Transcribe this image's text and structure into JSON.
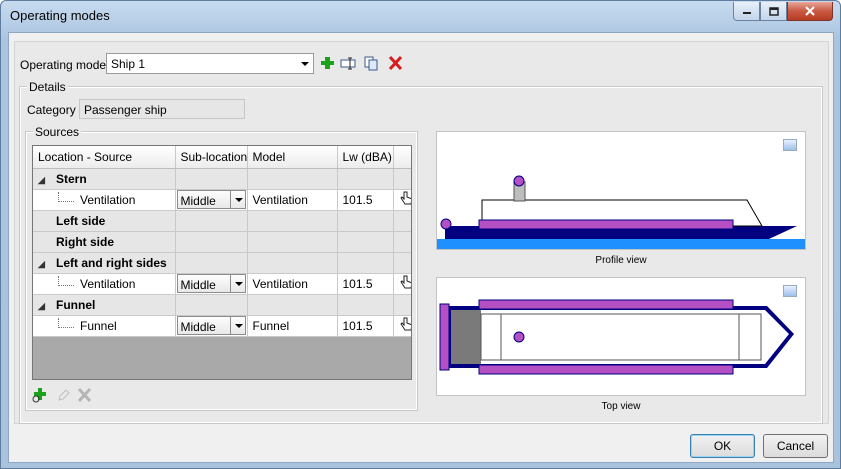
{
  "window": {
    "title": "Operating modes"
  },
  "operating_mode": {
    "label": "Operating mode",
    "value": "Ship 1"
  },
  "details": {
    "caption": "Details",
    "category_label": "Category",
    "category_value": "Passenger ship"
  },
  "sources": {
    "caption": "Sources",
    "columns": [
      "Location - Source",
      "Sub-location",
      "Model",
      "Lw (dBA)"
    ],
    "rows": [
      {
        "type": "group",
        "label": "Stern",
        "expandable": true
      },
      {
        "type": "leaf",
        "label": "Ventilation",
        "sub": "Middle",
        "model": "Ventilation",
        "lw": "101.5"
      },
      {
        "type": "group",
        "label": "Left side",
        "expandable": false
      },
      {
        "type": "group",
        "label": "Right side",
        "expandable": false
      },
      {
        "type": "group",
        "label": "Left and right sides",
        "expandable": true
      },
      {
        "type": "leaf",
        "label": "Ventilation",
        "sub": "Middle",
        "model": "Ventilation",
        "lw": "101.5"
      },
      {
        "type": "group",
        "label": "Funnel",
        "expandable": true
      },
      {
        "type": "leaf",
        "label": "Funnel",
        "sub": "Middle",
        "model": "Funnel",
        "lw": "101.5"
      }
    ]
  },
  "views": {
    "profile_caption": "Profile view",
    "top_caption": "Top view"
  },
  "buttons": {
    "ok": "OK",
    "cancel": "Cancel"
  },
  "colors": {
    "hull": "#000080",
    "deck": "#b44fc4",
    "water": "#1e90ff",
    "add": "#1aa31a",
    "delete": "#d81b1b"
  }
}
